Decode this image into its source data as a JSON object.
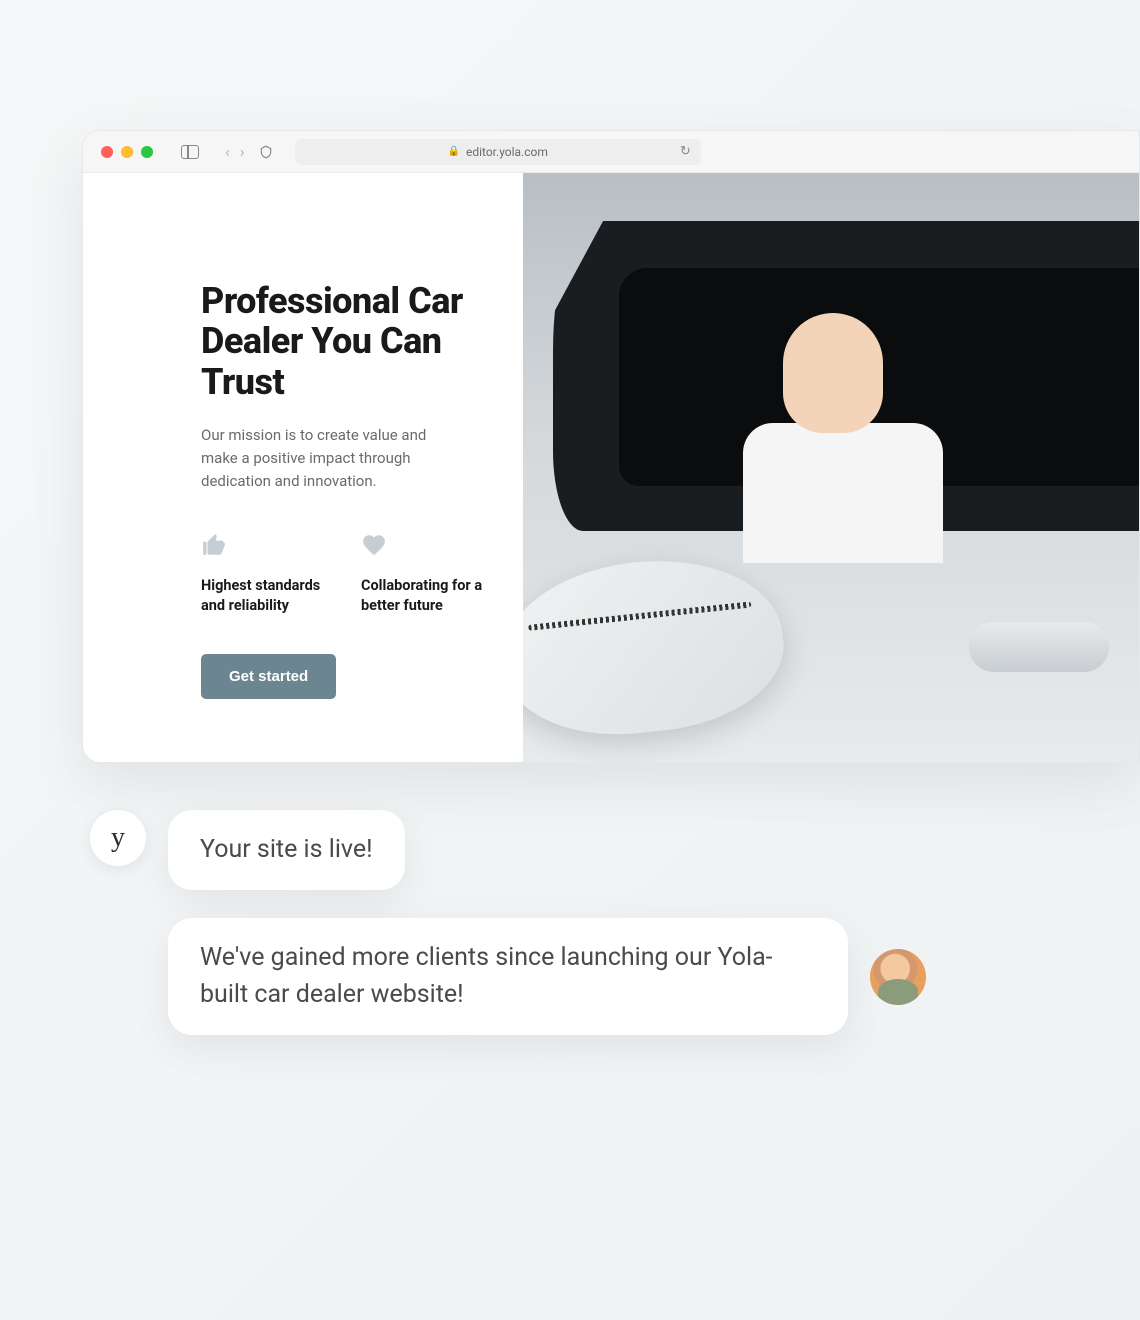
{
  "browser": {
    "url": "editor.yola.com"
  },
  "hero": {
    "title": "Professional Car Dealer You Can Trust",
    "description": "Our mission is to create value and make a positive impact through dedication and innovation.",
    "features": [
      {
        "icon": "thumbs-up",
        "text": "Highest standards and reliability"
      },
      {
        "icon": "heart",
        "text": "Collaborating for a better future"
      }
    ],
    "cta_label": "Get started"
  },
  "chat": {
    "bot_avatar_letter": "y",
    "messages": [
      {
        "from": "bot",
        "text": "Your site is live!"
      },
      {
        "from": "user",
        "text": "We've gained more clients since launching our Yola-built car dealer website!"
      }
    ]
  }
}
